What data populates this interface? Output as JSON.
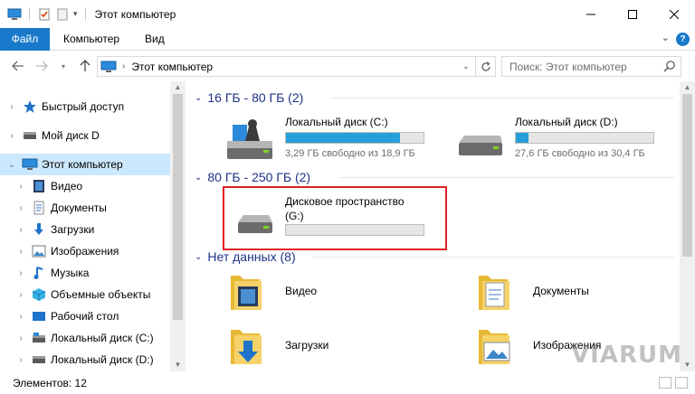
{
  "window": {
    "title": "Этот компьютер"
  },
  "ribbon": {
    "tabs": [
      "Файл",
      "Компьютер",
      "Вид"
    ],
    "help": "?"
  },
  "navbar": {
    "breadcrumb": "Этот компьютер",
    "search_placeholder": "Поиск: Этот компьютер"
  },
  "sidebar": {
    "items": [
      {
        "label": "Быстрый доступ",
        "icon": "star-icon"
      },
      {
        "label": "Мой диск D",
        "icon": "drive-icon"
      },
      {
        "label": "Этот компьютер",
        "icon": "computer-icon"
      },
      {
        "label": "Видео",
        "icon": "video-folder-icon"
      },
      {
        "label": "Документы",
        "icon": "documents-folder-icon"
      },
      {
        "label": "Загрузки",
        "icon": "downloads-folder-icon"
      },
      {
        "label": "Изображения",
        "icon": "pictures-folder-icon"
      },
      {
        "label": "Музыка",
        "icon": "music-folder-icon"
      },
      {
        "label": "Объемные объекты",
        "icon": "3d-objects-folder-icon"
      },
      {
        "label": "Рабочий стол",
        "icon": "desktop-folder-icon"
      },
      {
        "label": "Локальный диск (C:)",
        "icon": "system-drive-icon"
      },
      {
        "label": "Локальный диск (D:)",
        "icon": "drive-icon"
      }
    ]
  },
  "groups": [
    {
      "title": "16 ГБ - 80 ГБ (2)"
    },
    {
      "title": "80 ГБ - 250 ГБ (2)"
    },
    {
      "title": "Нет данных (8)"
    }
  ],
  "drives": [
    {
      "name": "Локальный диск (C:)",
      "free": "3,29 ГБ свободно из 18,9 ГБ",
      "used_fraction": 0.83,
      "icon": "system-drive-icon"
    },
    {
      "name": "Локальный диск (D:)",
      "free": "27,6 ГБ свободно из 30,4 ГБ",
      "used_fraction": 0.09,
      "icon": "drive-icon"
    },
    {
      "name": "Дисковое пространство",
      "name2": "(G:)",
      "used_fraction": 0,
      "icon": "drive-icon"
    }
  ],
  "folders": [
    {
      "name": "Видео",
      "icon": "video-folder-icon"
    },
    {
      "name": "Документы",
      "icon": "documents-folder-icon"
    },
    {
      "name": "Загрузки",
      "icon": "downloads-folder-icon"
    },
    {
      "name": "Изображения",
      "icon": "pictures-folder-icon"
    }
  ],
  "status": {
    "count": "Элементов: 12"
  },
  "watermark": "VIARUM",
  "colors": {
    "accent": "#1979ca",
    "selection": "#cce8ff",
    "bar_fill": "#26a0da",
    "group_header": "#1e3287",
    "highlight": "#e01f25"
  }
}
